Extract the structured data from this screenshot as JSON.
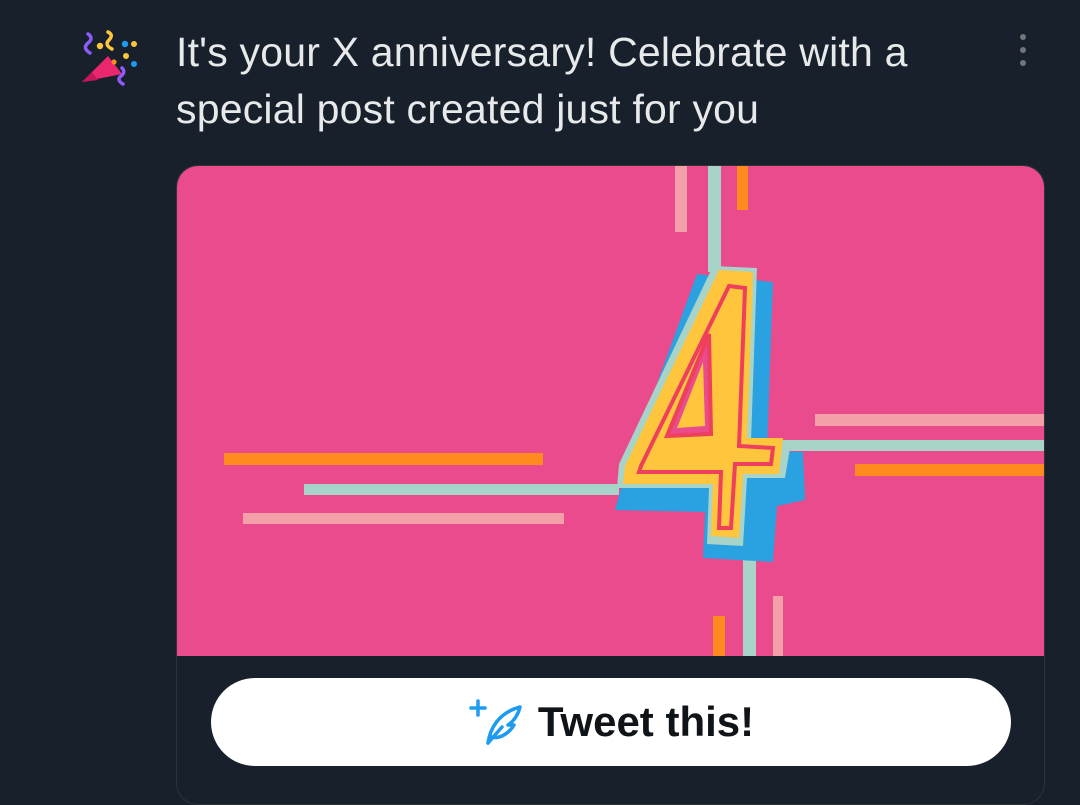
{
  "notification": {
    "icon": "party-popper-icon",
    "headline": "It's your X anniversary! Celebrate with a special post created just for you",
    "more_icon": "more-vertical-icon"
  },
  "card": {
    "image_number": "4",
    "image_colors": {
      "background": "#e94b8c",
      "strip_teal": "#a7d3c8",
      "strip_orange": "#ff8a1e",
      "strip_pink": "#f4a0a8",
      "number_yellow": "#ffc53d",
      "number_blue": "#2aa1e0",
      "number_red": "#ee3f5c"
    },
    "button": {
      "label": "Tweet this!",
      "icon": "compose-feather-icon"
    }
  },
  "colors": {
    "page_background": "#17202b",
    "text": "#e7e9ea",
    "accent": "#1d9bf0"
  }
}
